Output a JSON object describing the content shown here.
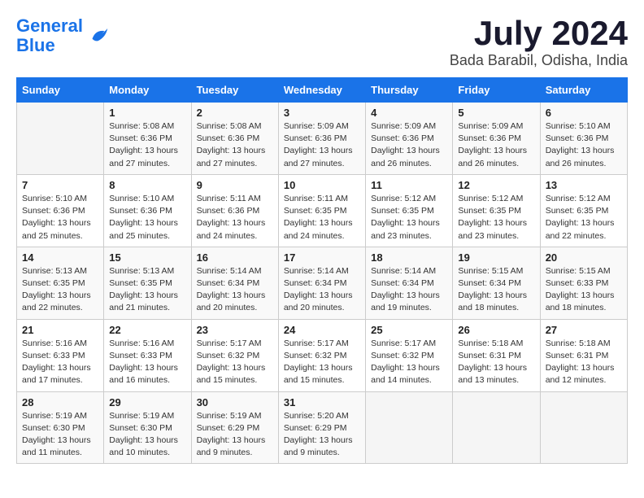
{
  "header": {
    "logo_line1": "General",
    "logo_line2": "Blue",
    "month": "July 2024",
    "location": "Bada Barabil, Odisha, India"
  },
  "weekdays": [
    "Sunday",
    "Monday",
    "Tuesday",
    "Wednesday",
    "Thursday",
    "Friday",
    "Saturday"
  ],
  "weeks": [
    [
      {
        "day": "",
        "info": ""
      },
      {
        "day": "1",
        "info": "Sunrise: 5:08 AM\nSunset: 6:36 PM\nDaylight: 13 hours\nand 27 minutes."
      },
      {
        "day": "2",
        "info": "Sunrise: 5:08 AM\nSunset: 6:36 PM\nDaylight: 13 hours\nand 27 minutes."
      },
      {
        "day": "3",
        "info": "Sunrise: 5:09 AM\nSunset: 6:36 PM\nDaylight: 13 hours\nand 27 minutes."
      },
      {
        "day": "4",
        "info": "Sunrise: 5:09 AM\nSunset: 6:36 PM\nDaylight: 13 hours\nand 26 minutes."
      },
      {
        "day": "5",
        "info": "Sunrise: 5:09 AM\nSunset: 6:36 PM\nDaylight: 13 hours\nand 26 minutes."
      },
      {
        "day": "6",
        "info": "Sunrise: 5:10 AM\nSunset: 6:36 PM\nDaylight: 13 hours\nand 26 minutes."
      }
    ],
    [
      {
        "day": "7",
        "info": "Sunrise: 5:10 AM\nSunset: 6:36 PM\nDaylight: 13 hours\nand 25 minutes."
      },
      {
        "day": "8",
        "info": "Sunrise: 5:10 AM\nSunset: 6:36 PM\nDaylight: 13 hours\nand 25 minutes."
      },
      {
        "day": "9",
        "info": "Sunrise: 5:11 AM\nSunset: 6:36 PM\nDaylight: 13 hours\nand 24 minutes."
      },
      {
        "day": "10",
        "info": "Sunrise: 5:11 AM\nSunset: 6:35 PM\nDaylight: 13 hours\nand 24 minutes."
      },
      {
        "day": "11",
        "info": "Sunrise: 5:12 AM\nSunset: 6:35 PM\nDaylight: 13 hours\nand 23 minutes."
      },
      {
        "day": "12",
        "info": "Sunrise: 5:12 AM\nSunset: 6:35 PM\nDaylight: 13 hours\nand 23 minutes."
      },
      {
        "day": "13",
        "info": "Sunrise: 5:12 AM\nSunset: 6:35 PM\nDaylight: 13 hours\nand 22 minutes."
      }
    ],
    [
      {
        "day": "14",
        "info": "Sunrise: 5:13 AM\nSunset: 6:35 PM\nDaylight: 13 hours\nand 22 minutes."
      },
      {
        "day": "15",
        "info": "Sunrise: 5:13 AM\nSunset: 6:35 PM\nDaylight: 13 hours\nand 21 minutes."
      },
      {
        "day": "16",
        "info": "Sunrise: 5:14 AM\nSunset: 6:34 PM\nDaylight: 13 hours\nand 20 minutes."
      },
      {
        "day": "17",
        "info": "Sunrise: 5:14 AM\nSunset: 6:34 PM\nDaylight: 13 hours\nand 20 minutes."
      },
      {
        "day": "18",
        "info": "Sunrise: 5:14 AM\nSunset: 6:34 PM\nDaylight: 13 hours\nand 19 minutes."
      },
      {
        "day": "19",
        "info": "Sunrise: 5:15 AM\nSunset: 6:34 PM\nDaylight: 13 hours\nand 18 minutes."
      },
      {
        "day": "20",
        "info": "Sunrise: 5:15 AM\nSunset: 6:33 PM\nDaylight: 13 hours\nand 18 minutes."
      }
    ],
    [
      {
        "day": "21",
        "info": "Sunrise: 5:16 AM\nSunset: 6:33 PM\nDaylight: 13 hours\nand 17 minutes."
      },
      {
        "day": "22",
        "info": "Sunrise: 5:16 AM\nSunset: 6:33 PM\nDaylight: 13 hours\nand 16 minutes."
      },
      {
        "day": "23",
        "info": "Sunrise: 5:17 AM\nSunset: 6:32 PM\nDaylight: 13 hours\nand 15 minutes."
      },
      {
        "day": "24",
        "info": "Sunrise: 5:17 AM\nSunset: 6:32 PM\nDaylight: 13 hours\nand 15 minutes."
      },
      {
        "day": "25",
        "info": "Sunrise: 5:17 AM\nSunset: 6:32 PM\nDaylight: 13 hours\nand 14 minutes."
      },
      {
        "day": "26",
        "info": "Sunrise: 5:18 AM\nSunset: 6:31 PM\nDaylight: 13 hours\nand 13 minutes."
      },
      {
        "day": "27",
        "info": "Sunrise: 5:18 AM\nSunset: 6:31 PM\nDaylight: 13 hours\nand 12 minutes."
      }
    ],
    [
      {
        "day": "28",
        "info": "Sunrise: 5:19 AM\nSunset: 6:30 PM\nDaylight: 13 hours\nand 11 minutes."
      },
      {
        "day": "29",
        "info": "Sunrise: 5:19 AM\nSunset: 6:30 PM\nDaylight: 13 hours\nand 10 minutes."
      },
      {
        "day": "30",
        "info": "Sunrise: 5:19 AM\nSunset: 6:29 PM\nDaylight: 13 hours\nand 9 minutes."
      },
      {
        "day": "31",
        "info": "Sunrise: 5:20 AM\nSunset: 6:29 PM\nDaylight: 13 hours\nand 9 minutes."
      },
      {
        "day": "",
        "info": ""
      },
      {
        "day": "",
        "info": ""
      },
      {
        "day": "",
        "info": ""
      }
    ]
  ]
}
